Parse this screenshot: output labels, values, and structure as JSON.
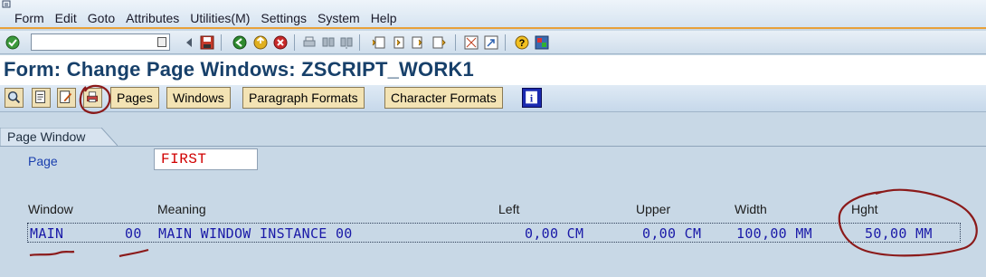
{
  "menu": [
    "Form",
    "Edit",
    "Goto",
    "Attributes",
    "Utilities(M)",
    "Settings",
    "System",
    "Help"
  ],
  "command_field": {
    "value": ""
  },
  "title": "Form: Change Page Windows: ZSCRIPT_WORK1",
  "app_toolbar": {
    "buttons": [
      "Pages",
      "Windows",
      "Paragraph Formats",
      "Character Formats"
    ],
    "icons": [
      "find-icon",
      "display-change-icon",
      "edit-icon",
      "print-preview-icon",
      "info-icon"
    ]
  },
  "tab": {
    "label": "Page Window"
  },
  "page_field": {
    "label": "Page",
    "value": "FIRST"
  },
  "table": {
    "headers": [
      "Window",
      "Meaning",
      "Left",
      "Upper",
      "Width",
      "Hght"
    ],
    "row": {
      "window": "MAIN",
      "instance": "00",
      "meaning": "MAIN WINDOW INSTANCE 00",
      "left": "0,00 CM",
      "upper": "0,00 CM",
      "width": "100,00 MM",
      "height": "50,00 MM"
    }
  },
  "colors": {
    "title": "#17406a",
    "annotation": "#8b1a1a",
    "field_value": "#d00000",
    "table_text": "#1a1aa8"
  }
}
